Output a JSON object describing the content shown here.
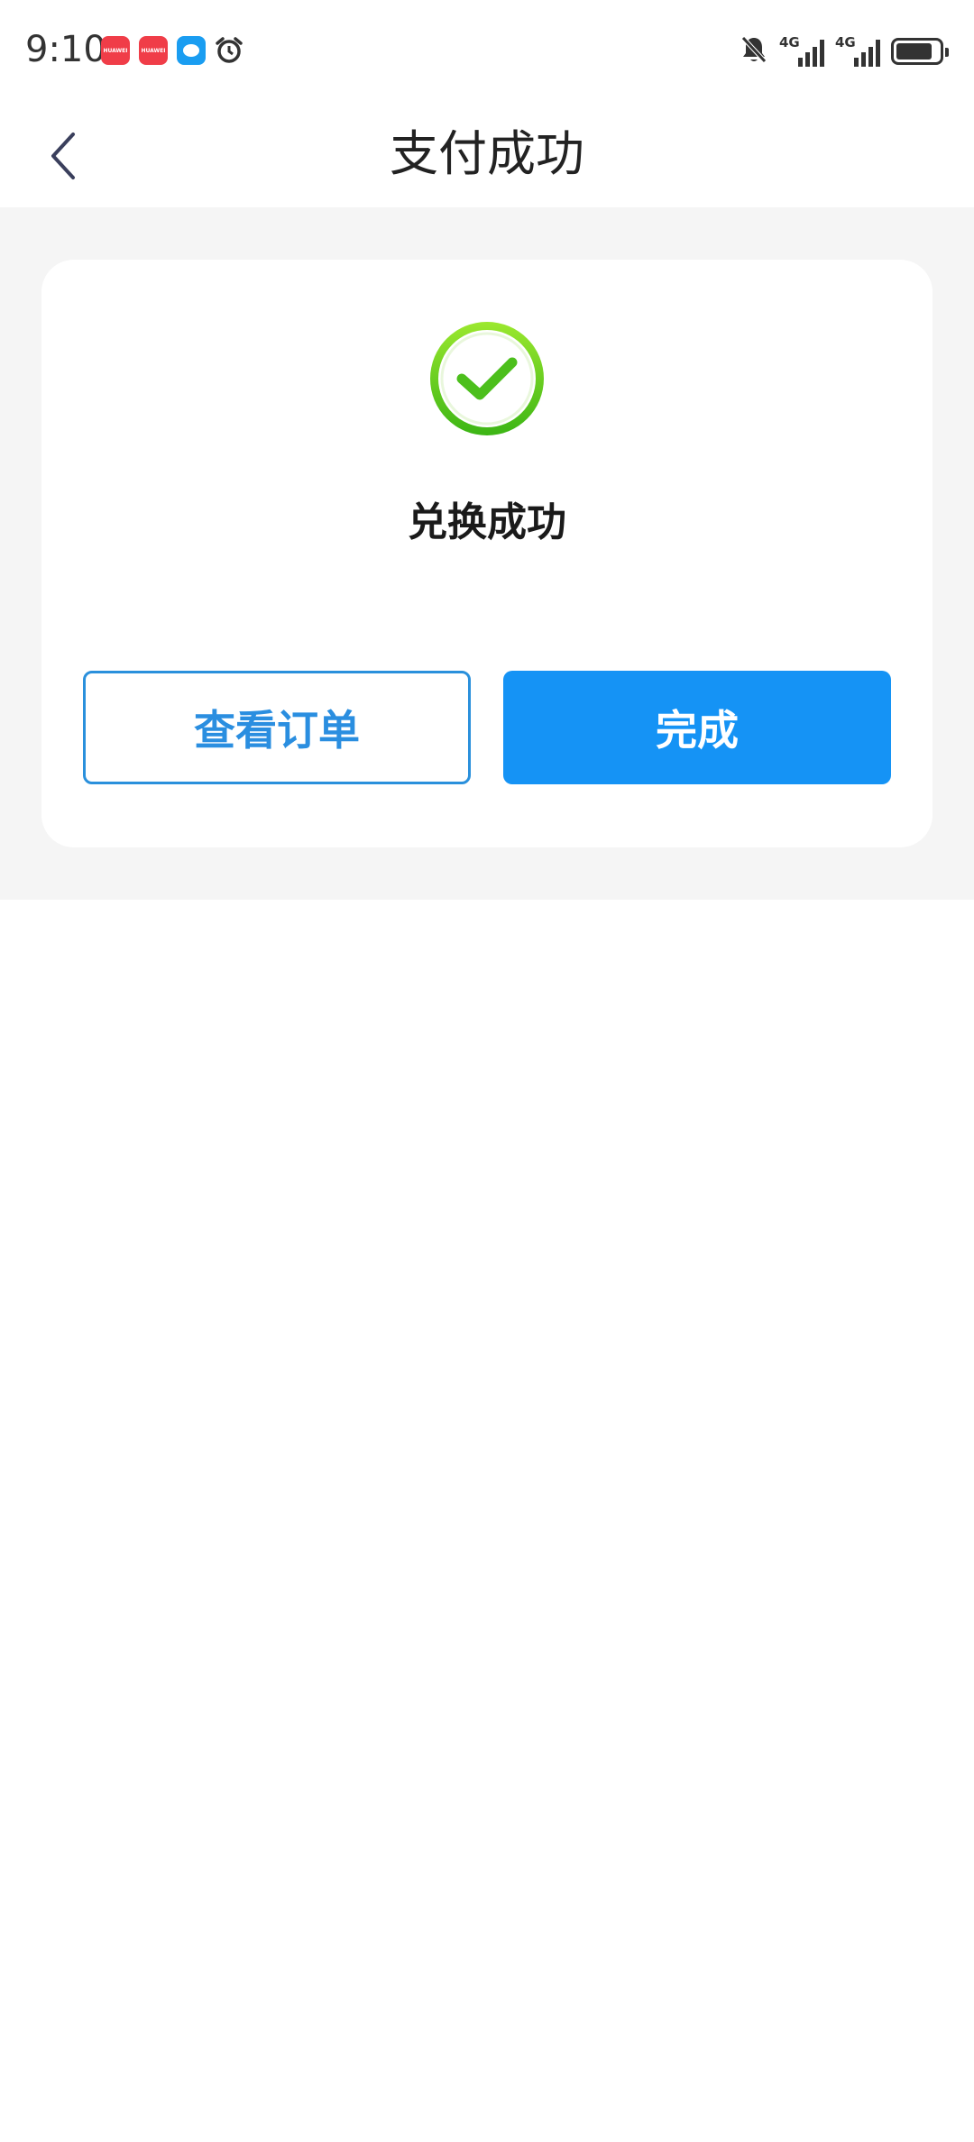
{
  "status_bar": {
    "time": "9:10",
    "notification_icons": [
      "huawei-appgallery-icon",
      "huawei-appgallery-icon",
      "messages-icon",
      "alarm-icon"
    ],
    "huawei_label": "HUAWEI",
    "network_1": "4G",
    "network_2": "4G",
    "battery_level": 0.85
  },
  "nav": {
    "title": "支付成功"
  },
  "result": {
    "message": "兑换成功",
    "icon": "success-check-icon"
  },
  "actions": {
    "view_order_label": "查看订单",
    "done_label": "完成"
  },
  "colors": {
    "primary": "#1593f5",
    "success": "#52c41a",
    "background": "#f5f5f5"
  }
}
